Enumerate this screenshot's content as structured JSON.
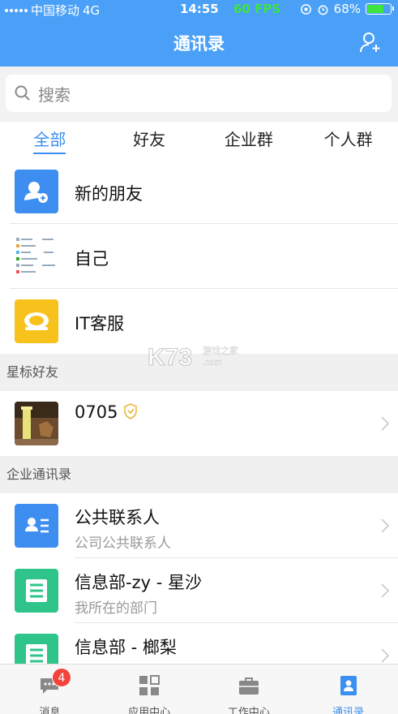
{
  "status_bar": {
    "carrier": "中国移动",
    "network": "4G",
    "time": "14:55",
    "fps": "60 FPS",
    "battery": "68%",
    "battery_level": 0.68
  },
  "header": {
    "title": "通讯录"
  },
  "search": {
    "placeholder": "搜索"
  },
  "tabs": [
    {
      "label": "全部",
      "active": true
    },
    {
      "label": "好友",
      "active": false
    },
    {
      "label": "企业群",
      "active": false
    },
    {
      "label": "个人群",
      "active": false
    }
  ],
  "top_items": [
    {
      "name": "新的朋友",
      "icon": "add-friend-icon",
      "color": "#3d8ef0"
    },
    {
      "name": "自己",
      "icon": "self-avatar"
    },
    {
      "name": "IT客服",
      "icon": "headset-icon",
      "color": "#f8c21c"
    }
  ],
  "starred": {
    "title": "星标好友",
    "items": [
      {
        "name": "0705",
        "badge_icon": "shield-badge-icon"
      }
    ]
  },
  "enterprise": {
    "title": "企业通讯录",
    "items": [
      {
        "name": "公共联系人",
        "subtitle": "公司公共联系人",
        "icon": "contacts-card-icon",
        "color": "#3d8ef0"
      },
      {
        "name": "信息部-zy - 星沙",
        "subtitle": "我所在的部门",
        "icon": "list-icon",
        "color": "#2fc58a"
      },
      {
        "name": "信息部 - 榔梨",
        "subtitle": "",
        "icon": "list-icon",
        "color": "#2fc58a"
      }
    ]
  },
  "tabbar": [
    {
      "label": "消息",
      "icon": "message-icon",
      "badge": "4",
      "active": false
    },
    {
      "label": "应用中心",
      "icon": "grid-icon",
      "active": false
    },
    {
      "label": "工作中心",
      "icon": "briefcase-icon",
      "active": false
    },
    {
      "label": "通讯录",
      "icon": "contacts-icon",
      "active": true
    }
  ],
  "accent_color": "#4aa0f7",
  "watermark": {
    "text": "游戏之家"
  }
}
